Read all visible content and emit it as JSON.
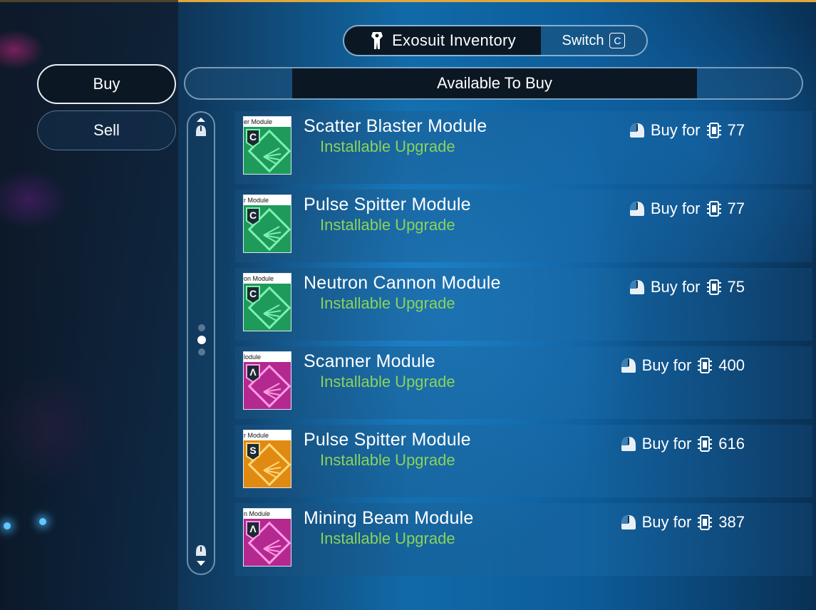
{
  "header": {
    "inventory_label": "Exosuit Inventory",
    "switch_label": "Switch",
    "switch_key": "C",
    "list_title": "Available To Buy"
  },
  "tabs": [
    {
      "label": "Buy",
      "selected": true
    },
    {
      "label": "Sell",
      "selected": false
    }
  ],
  "scroll": {
    "position": 0.5
  },
  "items": [
    {
      "thumb_label": "er Module",
      "name": "Scatter Blaster Module",
      "type": "Installable Upgrade",
      "buy_label": "Buy for",
      "price": "77",
      "class": "C",
      "color": "#1e9b5a",
      "glow": "#7ff0b0"
    },
    {
      "thumb_label": "r Module",
      "name": "Pulse Spitter Module",
      "type": "Installable Upgrade",
      "buy_label": "Buy for",
      "price": "77",
      "class": "C",
      "color": "#1e9b5a",
      "glow": "#7ff0b0"
    },
    {
      "thumb_label": "on Module",
      "name": "Neutron Cannon Module",
      "type": "Installable Upgrade",
      "buy_label": "Buy for",
      "price": "75",
      "class": "C",
      "color": "#1e9b5a",
      "glow": "#7ff0b0"
    },
    {
      "thumb_label": "lodule",
      "name": "Scanner Module",
      "type": "Installable Upgrade",
      "buy_label": "Buy for",
      "price": "400",
      "class": "Λ",
      "color": "#b3298f",
      "glow": "#ff9be6"
    },
    {
      "thumb_label": "r Module",
      "name": "Pulse Spitter Module",
      "type": "Installable Upgrade",
      "buy_label": "Buy for",
      "price": "616",
      "class": "S",
      "color": "#e08a12",
      "glow": "#ffd77a"
    },
    {
      "thumb_label": "n Module",
      "name": "Mining Beam Module",
      "type": "Installable Upgrade",
      "buy_label": "Buy for",
      "price": "387",
      "class": "Λ",
      "color": "#b3298f",
      "glow": "#ff9be6"
    }
  ]
}
